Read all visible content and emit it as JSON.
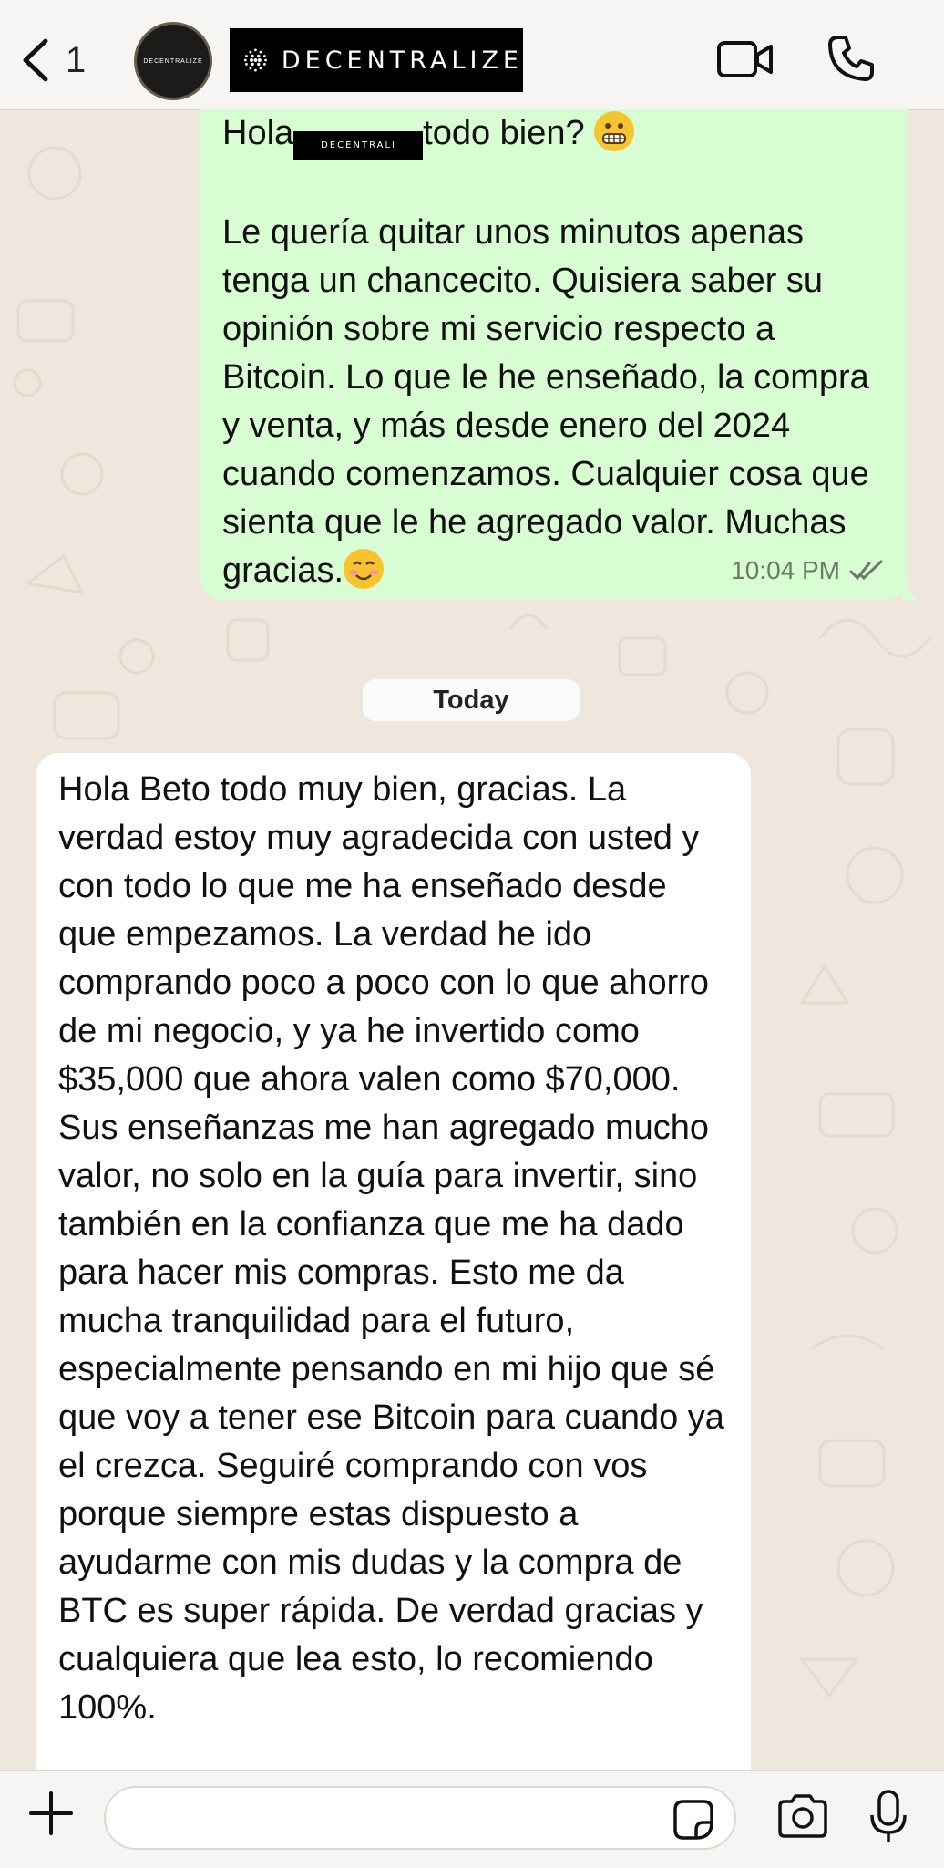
{
  "header": {
    "back_count": "1",
    "contact_name": "DECENTRALIZE",
    "avatar_label": "DECENTRALIZE"
  },
  "messages": {
    "outgoing": {
      "greeting_before": "Hola",
      "inline_logo": "DECENTRALI",
      "greeting_after": "todo bien? ",
      "body": "Le quería quitar unos minutos apenas tenga un chancecito. Quisiera saber su opinión sobre mi servicio respecto a Bitcoin. Lo que le he enseñado, la compra y venta, y más desde enero del 2024 cuando comenzamos. Cualquier cosa que sienta que le he agregado valor. Muchas gracias.",
      "time": "10:04 PM"
    },
    "day_separator": "Today",
    "incoming": {
      "body": "Hola Beto todo muy bien, gracias. La verdad estoy muy agradecida con usted y con todo lo que me ha enseñado desde que empezamos. La verdad he ido comprando poco a poco con lo que ahorro de mi negocio, y ya he invertido como $35,000 que ahora valen como $70,000. Sus enseñanzas me han agregado mucho valor, no solo en la guía para invertir, sino también en la confianza que me ha dado para hacer mis compras. Esto me da mucha tranquilidad para el futuro, especialmente pensando en mi hijo que sé que voy a tener ese Bitcoin para cuando ya el crezca. Seguiré comprando con vos porque siempre estas dispuesto a ayudarme con mis dudas y la compra de BTC es super rápida. De verdad gracias y cualquiera que lea esto, lo recomiendo 100%."
    }
  },
  "composer": {
    "value": ""
  },
  "colors": {
    "outgoing_bubble": "#d9fdd3",
    "incoming_bubble": "#ffffff",
    "read_ticks": "#6c7a6a",
    "chat_background": "#efe7dd"
  },
  "icons": [
    "chevron-left-icon",
    "video-camera-icon",
    "phone-icon",
    "plus-icon",
    "sticker-icon",
    "camera-icon",
    "microphone-icon",
    "double-check-icon"
  ]
}
